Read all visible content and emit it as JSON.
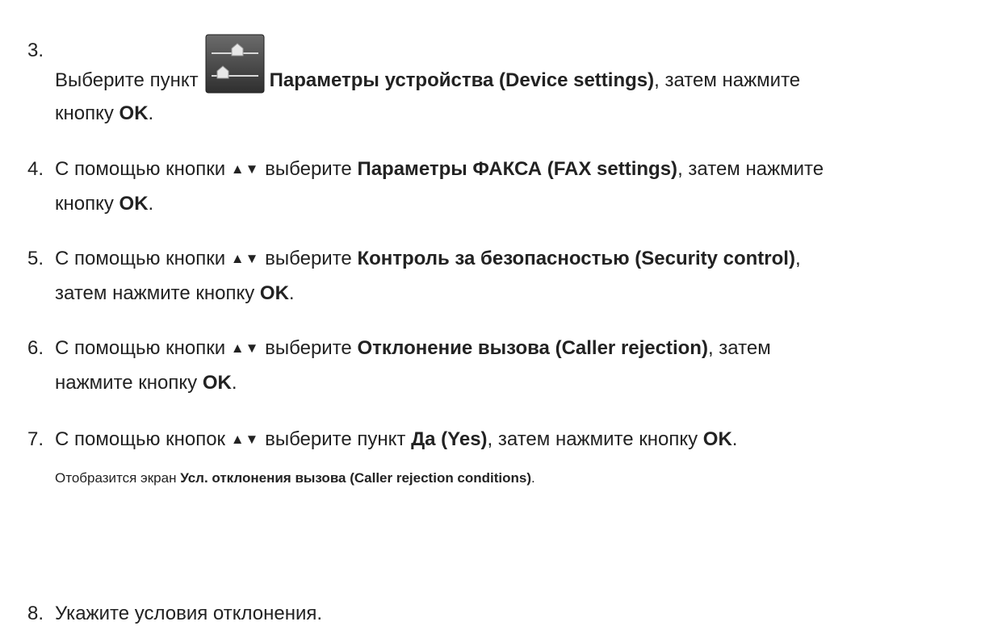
{
  "steps": [
    {
      "number": "3.",
      "t1": "Выберите пункт",
      "bold1": "Параметры устройства (Device settings)",
      "t2": ", затем нажмите",
      "t3": "кнопку",
      "bold2": "OK",
      "t4": "."
    },
    {
      "number": "4.",
      "t1": "С помощью кнопки",
      "arrows": "▲▼",
      "t2": "выберите",
      "bold1": "Параметры ФАКСА (FAX settings)",
      "t3": ", затем нажмите",
      "t4": "кнопку",
      "bold2": "OK",
      "t5": "."
    },
    {
      "number": "5.",
      "t1": "С помощью кнопки",
      "arrows": "▲▼",
      "t2": "выберите",
      "bold1": "Контроль за безопасностью (Security control)",
      "t3": ",",
      "t4": "затем нажмите кнопку",
      "bold2": "OK",
      "t5": "."
    },
    {
      "number": "6.",
      "t1": "С помощью кнопки",
      "arrows": "▲▼",
      "t2": "выберите",
      "bold1": "Отклонение вызова (Caller rejection)",
      "t3": ", затем",
      "t4": "нажмите кнопку",
      "bold2": "OK",
      "t5": "."
    },
    {
      "number": "7.",
      "t1": "С помощью кнопок",
      "arrows": "▲▼",
      "t2": "выберите пункт",
      "bold1": "Да (Yes)",
      "t3": ", затем нажмите кнопку",
      "bold2": "OK",
      "t4": ".",
      "note": {
        "t1": "Отобразится экран",
        "bold": "Усл. отклонения вызова (Caller rejection conditions)",
        "t2": "."
      }
    },
    {
      "number": "8.",
      "t1": "Укажите условия отклонения."
    }
  ],
  "icons": {
    "settings": "device-settings-icon"
  },
  "colors": {
    "text": "#222222",
    "icon_bg": "#4a4a4a",
    "icon_highlight": "#e8e8e8"
  }
}
